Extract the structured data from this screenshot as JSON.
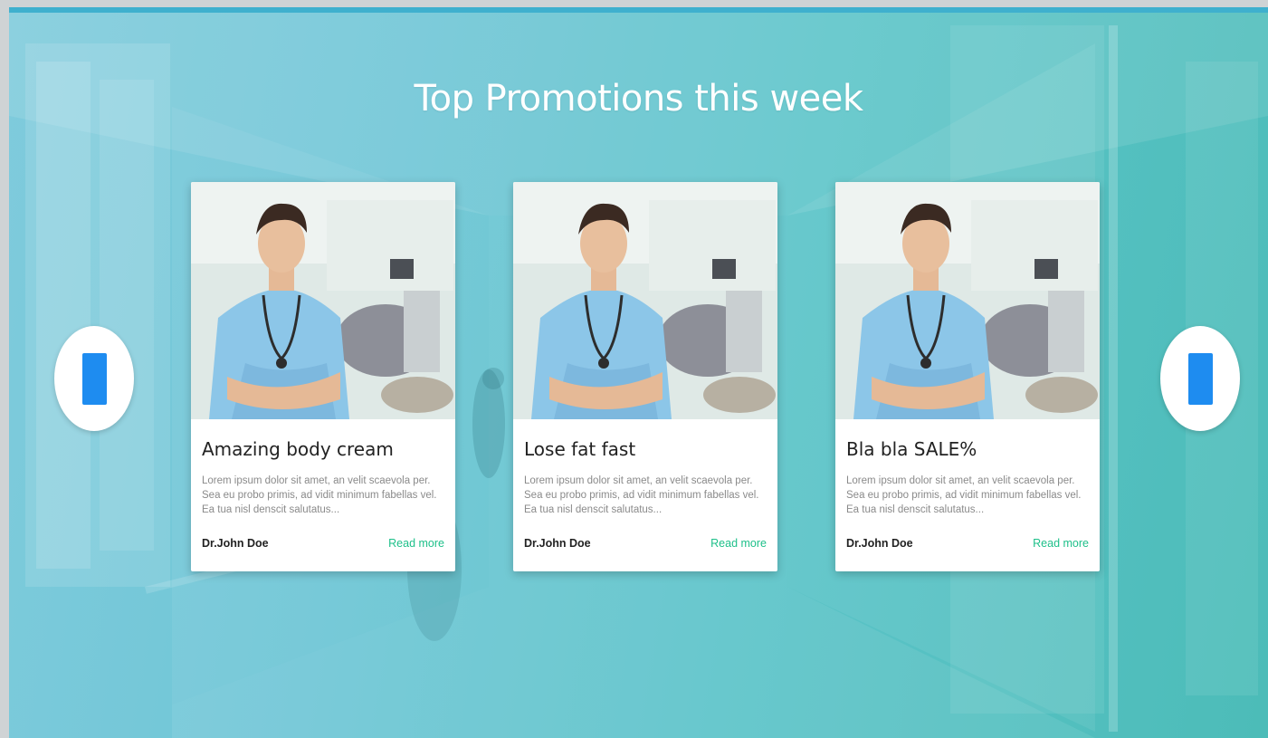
{
  "promotions": {
    "title": "Top Promotions this week",
    "cards": [
      {
        "title": "Amazing body cream",
        "body": "Lorem ipsum dolor sit amet, an velit scaevola per. Sea eu probo primis, ad vidit minimum fabellas vel. Ea tua nisl denscit salutatus...",
        "author": "Dr.John Doe",
        "more": "Read more"
      },
      {
        "title": "Lose fat fast",
        "body": "Lorem ipsum dolor sit amet, an velit scaevola per. Sea eu probo primis, ad vidit minimum fabellas vel. Ea tua nisl denscit salutatus...",
        "author": "Dr.John Doe",
        "more": "Read more"
      },
      {
        "title": "Bla bla SALE%",
        "body": "Lorem ipsum dolor sit amet, an velit scaevola per. Sea eu probo primis, ad vidit minimum fabellas vel. Ea tua nisl denscit salutatus...",
        "author": "Dr.John Doe",
        "more": "Read more"
      }
    ]
  },
  "navigation": {
    "prev_icon": "slider-prev-icon",
    "next_icon": "slider-next-icon"
  },
  "colors": {
    "hero_start": "#7fcbdc",
    "hero_end": "#4cbcb8",
    "accent_link": "#1fc08a",
    "nav_glyph": "#1e8cf0"
  }
}
